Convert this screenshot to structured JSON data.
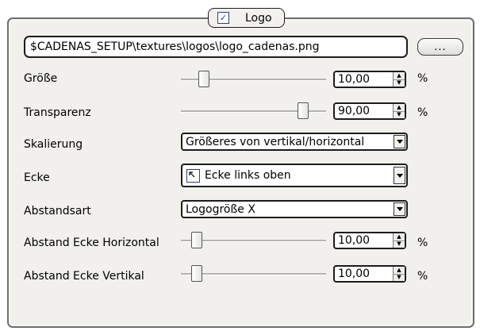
{
  "group": {
    "title": "Logo",
    "checked": true
  },
  "path": {
    "value": "$CADENAS_SETUP\\textures\\logos\\logo_cadenas.png",
    "browse_label": "..."
  },
  "size": {
    "label": "Größe",
    "slider_fraction": 0.16,
    "value": "10,00",
    "unit": "%"
  },
  "transparency": {
    "label": "Transparenz",
    "slider_fraction": 0.84,
    "value": "90,00",
    "unit": "%"
  },
  "scaling": {
    "label": "Skalierung",
    "value": "Größeres von vertikal/horizontal"
  },
  "corner": {
    "label": "Ecke",
    "value": "Ecke links oben",
    "icon": "arrow-top-left-icon"
  },
  "spacing_type": {
    "label": "Abstandsart",
    "value": "Logogröße X"
  },
  "spacing_horizontal": {
    "label": "Abstand Ecke Horizontal",
    "slider_fraction": 0.11,
    "value": "10,00",
    "unit": "%"
  },
  "spacing_vertical": {
    "label": "Abstand Ecke Vertikal",
    "slider_fraction": 0.11,
    "value": "10,00",
    "unit": "%"
  }
}
